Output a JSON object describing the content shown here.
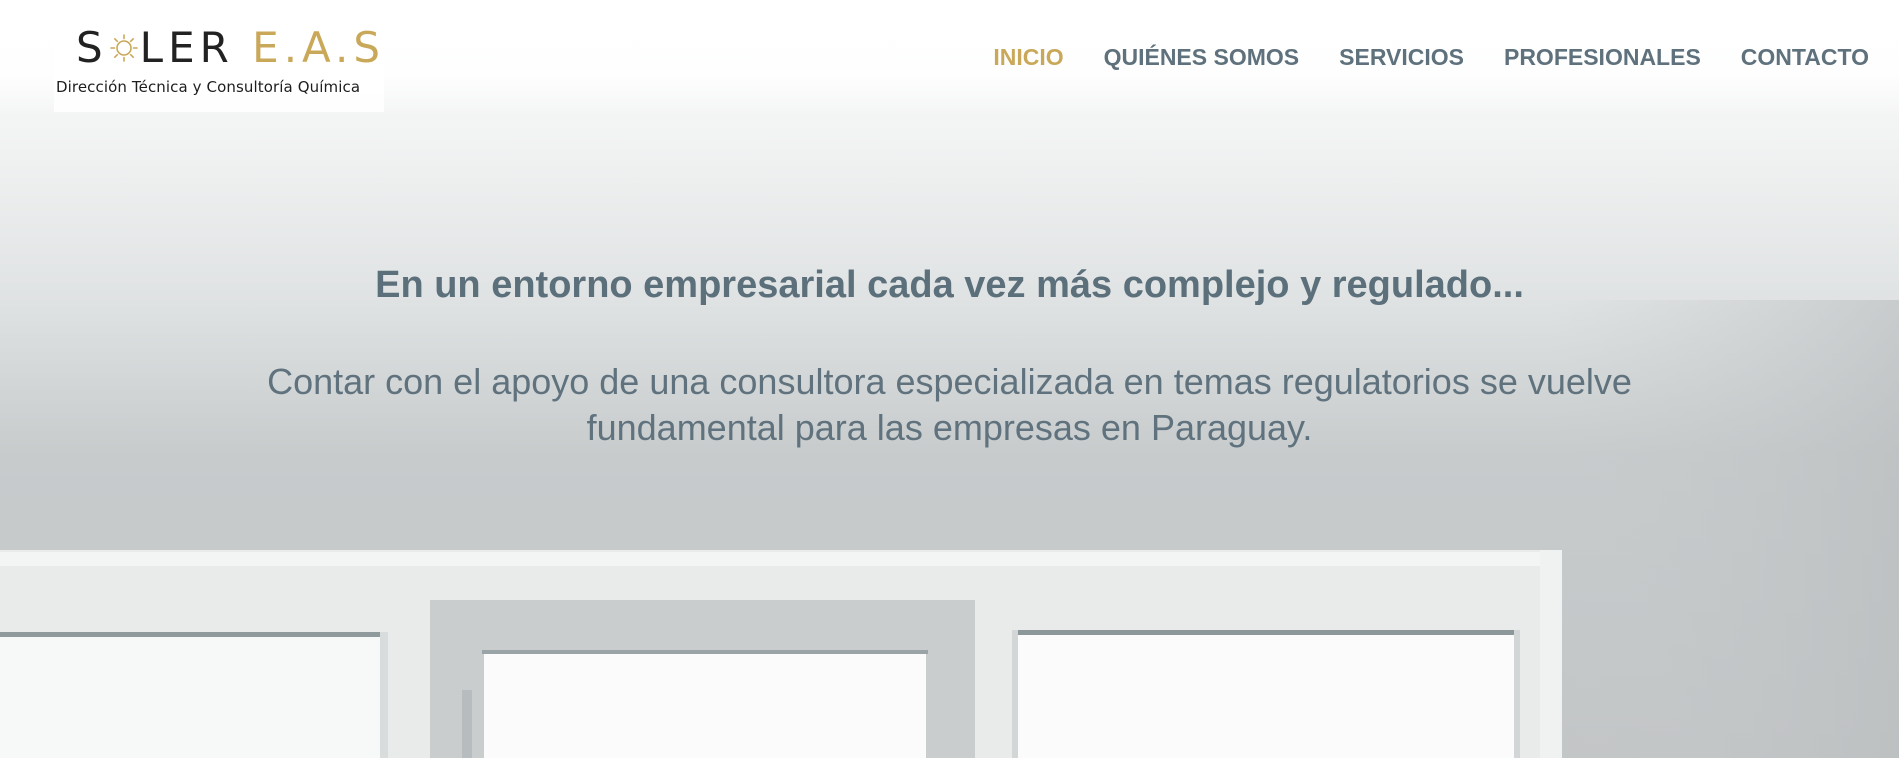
{
  "brand": {
    "logo_word_dark": "SOLER",
    "logo_word_gold": "E.A.S",
    "tagline": "Dirección Técnica y Consultoría Química",
    "colors": {
      "gold": "#c9a85a",
      "dark": "#222222",
      "nav": "#5e717c"
    }
  },
  "nav": {
    "items": [
      {
        "label": "INICIO",
        "active": true
      },
      {
        "label": "QUIÉNES SOMOS",
        "active": false
      },
      {
        "label": "SERVICIOS",
        "active": false
      },
      {
        "label": "PROFESIONALES",
        "active": false
      },
      {
        "label": "CONTACTO",
        "active": false
      }
    ]
  },
  "hero": {
    "title": "En un entorno empresarial cada vez más complejo y regulado...",
    "subtitle": "Contar con el apoyo de una consultora especializada en temas regulatorios se vuelve fundamental para las empresas en Paraguay."
  }
}
